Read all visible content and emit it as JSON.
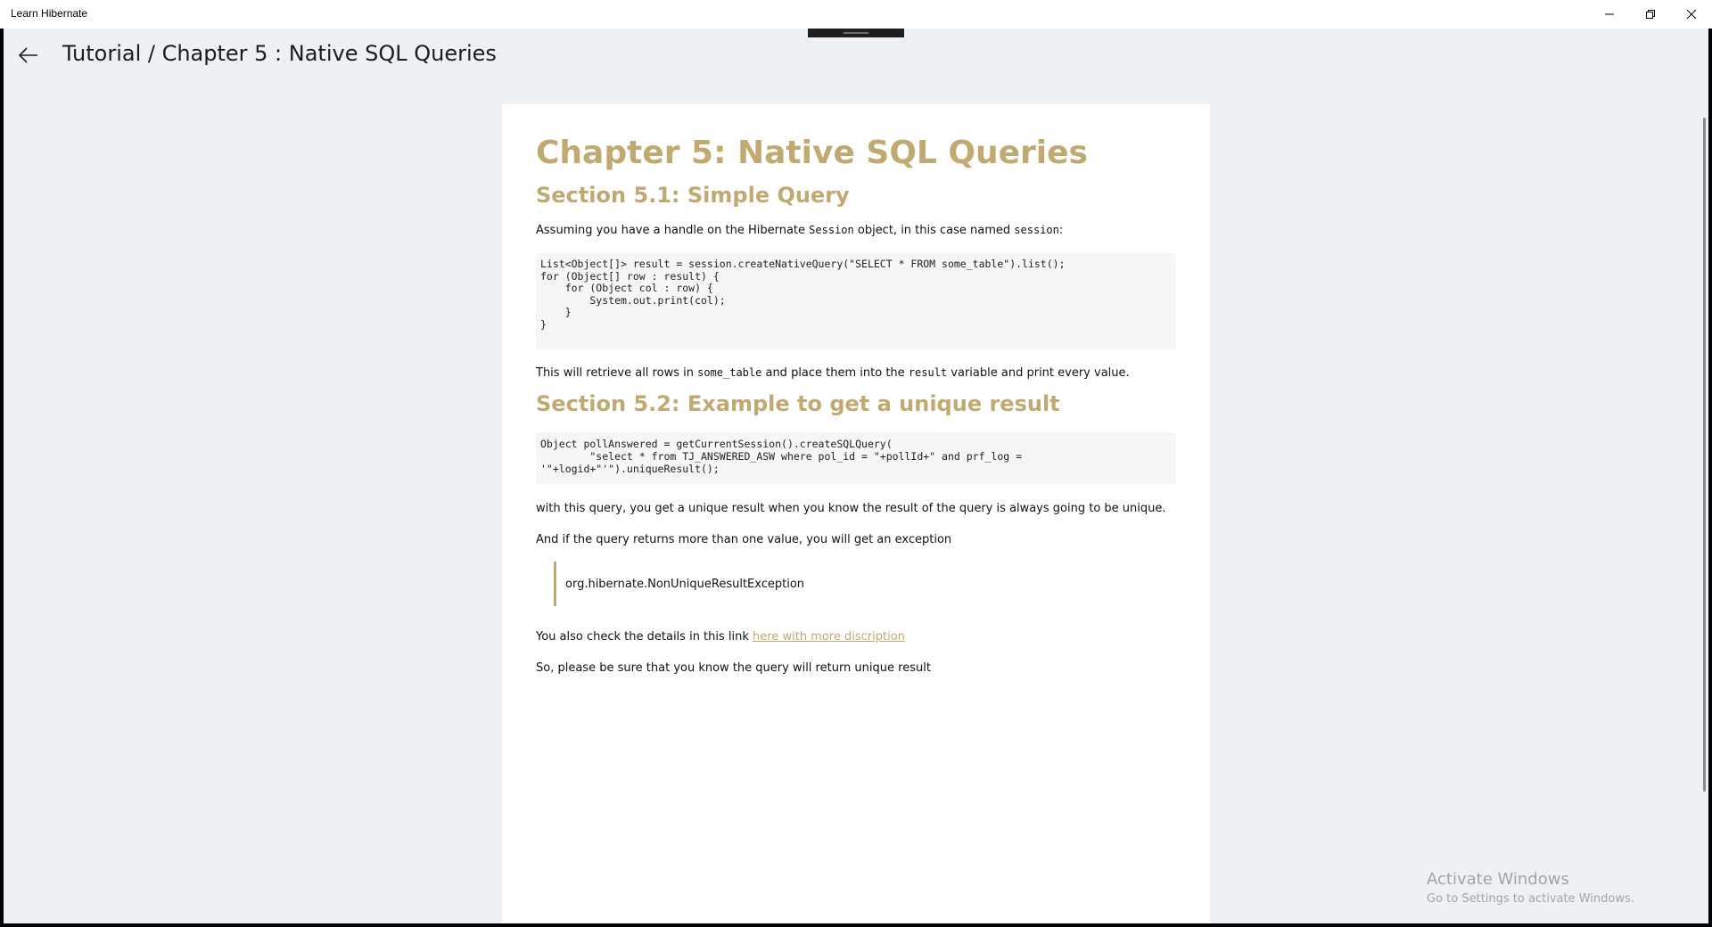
{
  "app": {
    "title": "Learn Hibernate"
  },
  "header": {
    "breadcrumb": "Tutorial / Chapter 5 :  Native SQL Queries"
  },
  "article": {
    "title": "Chapter 5: Native SQL Queries",
    "section1": {
      "heading": "Section 5.1: Simple Query",
      "intro_before": "Assuming you have a handle on the Hibernate ",
      "intro_code": "Session",
      "intro_after": " object, in this case named ",
      "intro_var": "session",
      "intro_end": ":",
      "code": {
        "l1": "List<Object[]> result = session.createNativeQuery(\"SELECT * FROM some_table\").list();",
        "l2": "for (Object[] row : result) {",
        "l3": "    for (Object col : row) {",
        "l4": "        System.out.print(col);",
        "l5": "    }",
        "l6": "}"
      },
      "after_1": "This will retrieve all rows in ",
      "after_code1": "some_table",
      "after_2": " and place them into the ",
      "after_code2": "result",
      "after_3": " variable and print every value."
    },
    "section2": {
      "heading": "Section 5.2: Example to get a unique result",
      "code": {
        "l1": "Object pollAnswered = getCurrentSession().createSQLQuery(",
        "l2": "        \"select * from TJ_ANSWERED_ASW where pol_id = \"+pollId+\" and prf_log =",
        "l3": "'\"+logid+\"'\").uniqueResult();"
      },
      "para1": "with this query, you get a unique result when you know the result of the query is always going to be unique.",
      "para2": "And if the query returns more than one value, you will get an exception",
      "quote": "org.hibernate.NonUniqueResultException",
      "link_prefix": "You also check the details in this link ",
      "link_text": "here with more discription",
      "para3": "So, please be sure that you know the query will return unique result"
    }
  },
  "watermark": {
    "line1": "Activate Windows",
    "line2": "Go to Settings to activate Windows."
  },
  "colors": {
    "accent": "#c1aa72",
    "background": "#eef1f4",
    "card": "#ffffff"
  }
}
